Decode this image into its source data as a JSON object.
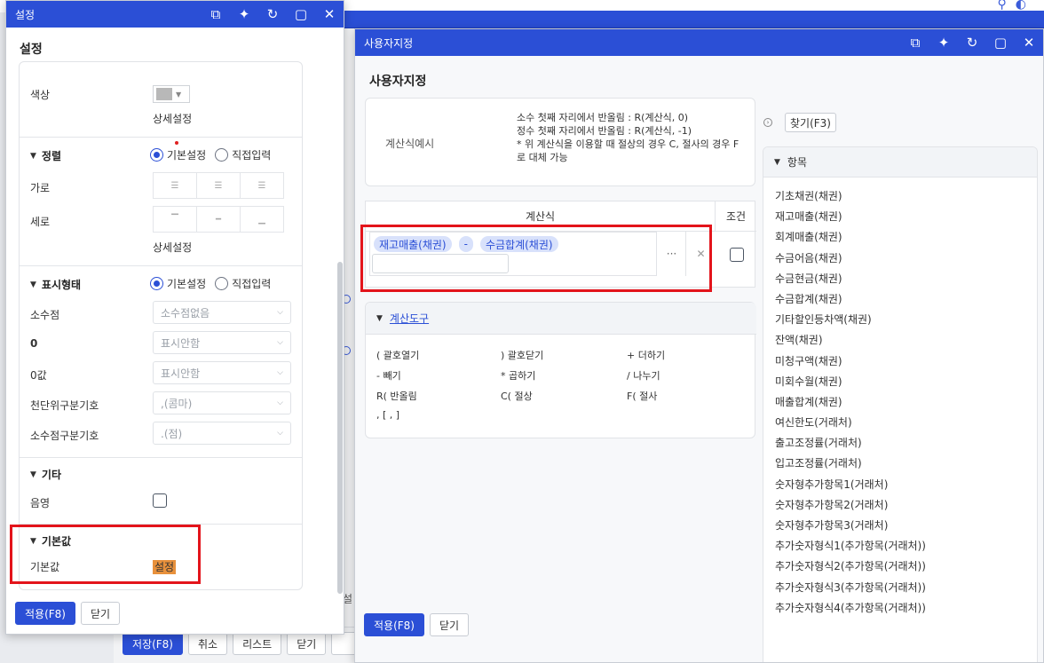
{
  "background": {
    "bottom_buttons": [
      "저장(F8)",
      "취소",
      "리스트",
      "닫기"
    ],
    "side_label": "설"
  },
  "settings_dialog": {
    "title": "설정",
    "heading": "설정",
    "color": {
      "label": "색상",
      "swatch": "#b8b8b8",
      "detail": "상세설정"
    },
    "align": {
      "title": "정렬",
      "radio_default": "기본설정",
      "radio_direct": "직접입력",
      "selected": "기본설정",
      "horizontal": "가로",
      "vertical": "세로",
      "detail": "상세설정"
    },
    "display": {
      "title": "표시형태",
      "radio_default": "기본설정",
      "radio_direct": "직접입력",
      "selected": "기본설정",
      "fields": [
        {
          "label": "소수점",
          "value": "소수점없음"
        },
        {
          "label": "0",
          "value": "표시안함"
        },
        {
          "label": "0값",
          "value": "표시안함"
        },
        {
          "label": "천단위구분기호",
          "value": ",(콤마)"
        },
        {
          "label": "소수점구분기호",
          "value": ".(점)"
        }
      ]
    },
    "etc": {
      "title": "기타",
      "shadow_label": "음영",
      "shadow_checked": false
    },
    "default": {
      "title": "기본값",
      "label": "기본값",
      "value": "설정"
    },
    "apply_button": "적용(F8)",
    "close_button": "닫기"
  },
  "custom_dialog": {
    "title": "사용자지정",
    "heading": "사용자지정",
    "example": {
      "label": "계산식예시",
      "lines": [
        "소수 첫째 자리에서 반올림 : R(계산식, 0)",
        "정수 첫째 자리에서 반올림 : R(계산식, -1)",
        "* 위 계산식을 이용할 때 절상의 경우 C, 절사의 경우 F로 대체 가능"
      ]
    },
    "formula": {
      "header": "계산식",
      "condition_header": "조건",
      "tokens": [
        "재고매출(채권)",
        "-",
        "수금합계(채권)"
      ],
      "dots": "···",
      "clear": "✕"
    },
    "tools": {
      "title": "계산도구",
      "items": [
        "( 괄호열기",
        ") 괄호닫기",
        "+ 더하기",
        "- 빼기",
        "* 곱하기",
        "/ 나누기",
        "R( 반올림",
        "C( 절상",
        "F( 절사",
        ", [ , ]"
      ]
    },
    "find_button": "찾기(F3)",
    "items_panel": {
      "title": "항목",
      "items": [
        "기초채권(채권)",
        "재고매출(채권)",
        "회계매출(채권)",
        "수금어음(채권)",
        "수금현금(채권)",
        "수금합계(채권)",
        "기타할인등차액(채권)",
        "잔액(채권)",
        "미청구액(채권)",
        "미회수월(채권)",
        "매출합계(채권)",
        "여신한도(거래처)",
        "출고조정률(거래처)",
        "입고조정률(거래처)",
        "숫자형추가항목1(거래처)",
        "숫자형추가항목2(거래처)",
        "숫자형추가항목3(거래처)",
        "추가숫자형식1(추가항목(거래처))",
        "추가숫자형식2(추가항목(거래처))",
        "추가숫자형식3(추가항목(거래처))",
        "추가숫자형식4(추가항목(거래처))"
      ]
    },
    "apply_button": "적용(F8)",
    "close_button": "닫기"
  }
}
